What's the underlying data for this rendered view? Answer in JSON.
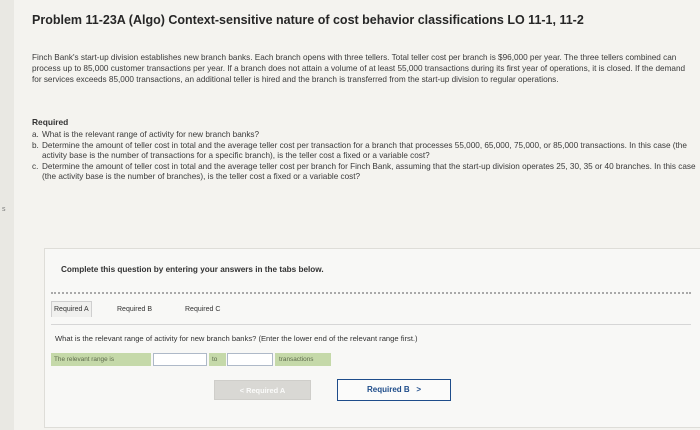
{
  "edge_mark": "s",
  "title": "Problem 11-23A (Algo) Context-sensitive nature of cost behavior classifications LO 11-1, 11-2",
  "intro": "Finch Bank's start-up division establishes new branch banks. Each branch opens with three tellers. Total teller cost per branch is $96,000 per year. The three tellers combined can process up to 85,000 customer transactions per year. If a branch does not attain a volume of at least 55,000 transactions during its first year of operations, it is closed. If the demand for services exceeds 85,000 transactions, an additional teller is hired and the branch is transferred from the start-up division to regular operations.",
  "required_heading": "Required",
  "requirements": [
    {
      "tag": "a.",
      "text": "What is the relevant range of activity for new branch banks?"
    },
    {
      "tag": "b.",
      "text": "Determine the amount of teller cost in total and the average teller cost per transaction for a branch that processes 55,000, 65,000, 75,000, or 85,000 transactions. In this case (the activity base is the number of transactions for a specific branch), is the teller cost a fixed or a variable cost?"
    },
    {
      "tag": "c.",
      "text": "Determine the amount of teller cost in total and the average teller cost per branch for Finch Bank, assuming that the start-up division operates 25, 30, 35 or 40 branches. In this case (the activity base is the number of branches), is the teller cost a fixed or a variable cost?"
    }
  ],
  "complete_line": "Complete this question by entering your answers in the tabs below.",
  "tabs": {
    "a": "Required A",
    "b": "Required B",
    "c": "Required C"
  },
  "question": "What is the relevant range of activity for new branch banks? (Enter the lower end of the relevant range first.)",
  "answer": {
    "range_label": "The relevant range is",
    "low_value": "",
    "to_label": "to",
    "high_value": "",
    "unit_label": "transactions"
  },
  "nav": {
    "prev_label": "Required A",
    "next_label": "Required B",
    "prev_chevron": "<",
    "next_chevron": ">"
  },
  "colors": {
    "answer_label_bg": "#c5d9a9",
    "next_button_border": "#1e4c8a",
    "prev_button_bg": "#d9d8d4"
  }
}
